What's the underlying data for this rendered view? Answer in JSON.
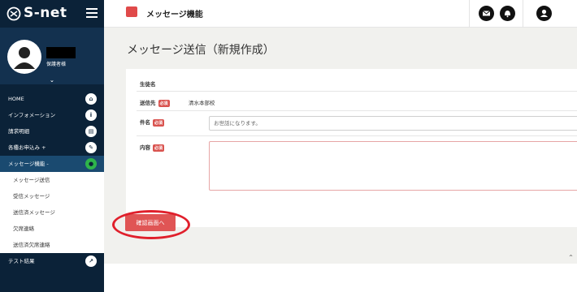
{
  "brand": {
    "name": "S-net"
  },
  "user": {
    "role": "保護者様"
  },
  "menu": {
    "items": [
      {
        "label": "HOME"
      },
      {
        "label": "インフォメーション"
      },
      {
        "label": "請求明細"
      },
      {
        "label": "各種お申込み +"
      },
      {
        "label": "メッセージ機能 -"
      }
    ],
    "submenu": [
      {
        "label": "メッセージ送信"
      },
      {
        "label": "受信メッセージ"
      },
      {
        "label": "送信済メッセージ"
      },
      {
        "label": "欠席連絡"
      },
      {
        "label": "送信済欠席連絡"
      }
    ],
    "bottom_item": {
      "label": "テスト結果"
    }
  },
  "topbar": {
    "title": "メッセージ機能"
  },
  "page": {
    "title": "メッセージ送信（新規作成）"
  },
  "form": {
    "student_label": "生徒名",
    "to_label": "送信先",
    "to_value": "清水本部校",
    "subject_label": "件名",
    "subject_value": "お世話になります。",
    "body_label": "内容",
    "required_badge": "必須",
    "confirm_button": "確認画面へ"
  },
  "colors": {
    "sidebar": "#0b2238",
    "accent": "#e05555",
    "highlight": "#e0202c"
  }
}
